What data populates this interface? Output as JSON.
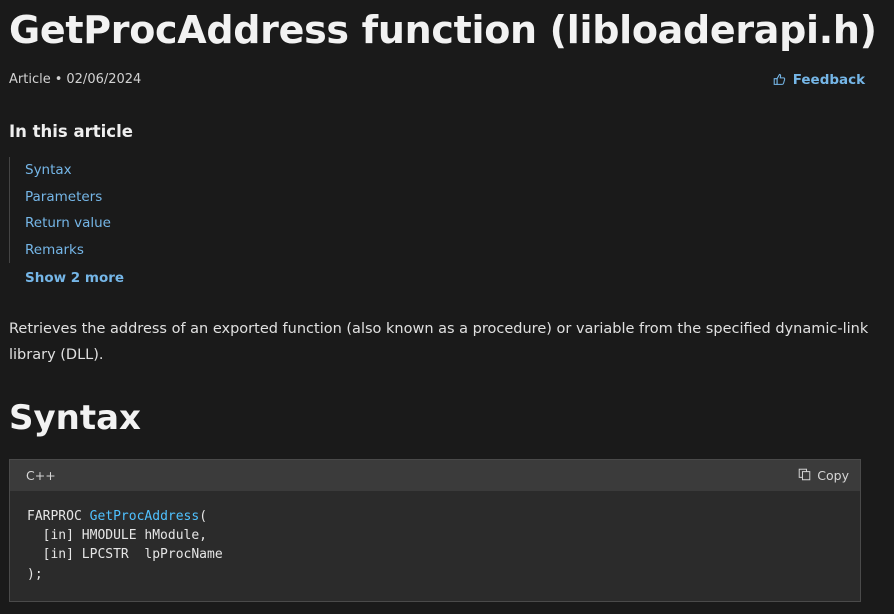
{
  "page_title": "GetProcAddress function (libloaderapi.h)",
  "meta": {
    "type": "Article",
    "separator": "•",
    "date": "02/06/2024"
  },
  "feedback_label": "Feedback",
  "toc": {
    "heading": "In this article",
    "items": [
      "Syntax",
      "Parameters",
      "Return value",
      "Remarks"
    ],
    "show_more": "Show 2 more"
  },
  "description": "Retrieves the address of an exported function (also known as a procedure) or variable from the specified dynamic-link library (DLL).",
  "syntax_heading": "Syntax",
  "code_block": {
    "language": "C++",
    "copy_label": "Copy",
    "line1_type": "FARPROC",
    "line1_fn": "GetProcAddress",
    "line1_paren": "(",
    "line2": "  [in] HMODULE hModule,",
    "line3": "  [in] LPCSTR  lpProcName",
    "line4": ");"
  },
  "colors": {
    "background": "#1a1a1a",
    "link": "#75b6e7",
    "function_name": "#4fc1ff"
  },
  "icons": {
    "feedback": "thumbs-up-icon",
    "copy": "copy-icon"
  }
}
